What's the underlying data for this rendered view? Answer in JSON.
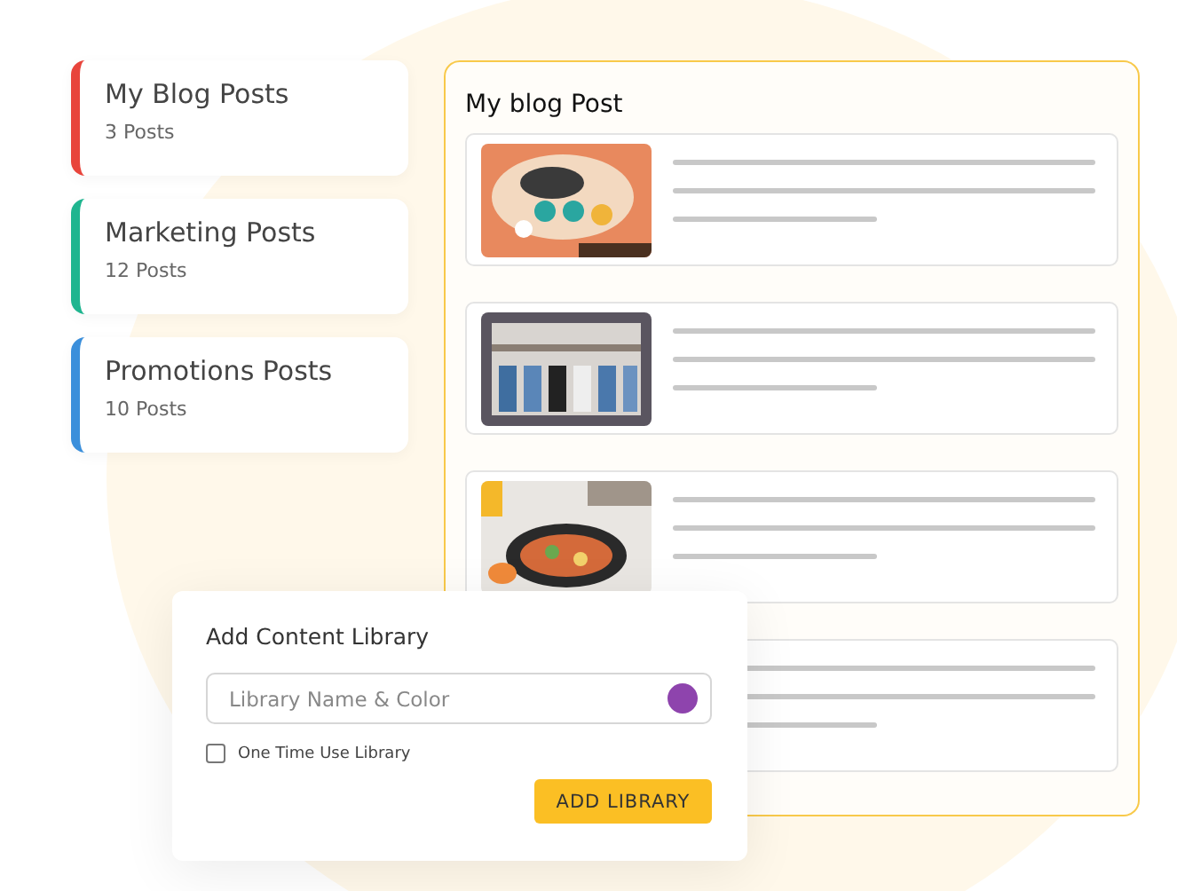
{
  "libraries": [
    {
      "title": "My Blog Posts",
      "count": "3 Posts",
      "color": "#e8453c"
    },
    {
      "title": "Marketing Posts",
      "count": "12 Posts",
      "color": "#1fb58f"
    },
    {
      "title": "Promotions Posts",
      "count": "10 Posts",
      "color": "#3b8fdb"
    }
  ],
  "panel": {
    "title": "My blog Post",
    "posts": [
      {
        "kind": "picture"
      },
      {
        "kind": "picture"
      },
      {
        "kind": "picture"
      },
      {
        "kind": "hidden"
      }
    ]
  },
  "dialog": {
    "title": "Add Content Library",
    "field": {
      "placeholder": "Library Name & Color",
      "color": "#8e44ad"
    },
    "checkbox": {
      "label": "One Time Use Library",
      "checked": false
    },
    "button": "ADD LIBRARY"
  }
}
